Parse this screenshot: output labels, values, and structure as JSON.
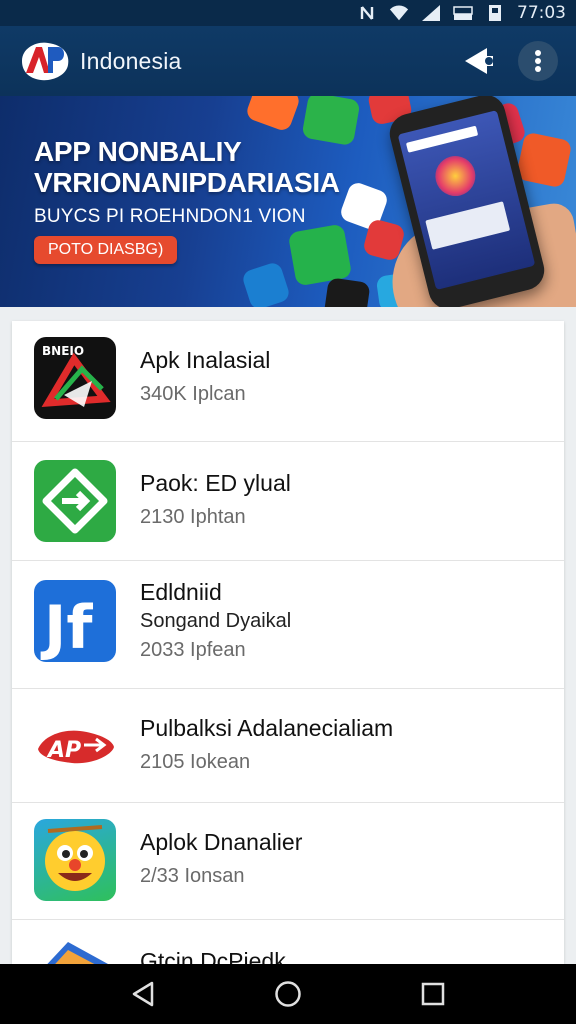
{
  "status_bar": {
    "time": "77:03",
    "icons": [
      "nfc-icon",
      "wifi-icon",
      "signal-icon",
      "battery-icon",
      "sim-icon"
    ]
  },
  "app_bar": {
    "logo_text": "AP",
    "title": "Indonesia",
    "icons": [
      "share-icon",
      "more-vert-icon"
    ]
  },
  "banner": {
    "title_line1": "APP NONBALIY",
    "title_line2": "VRRIONANIPDARIASIA",
    "subtitle": "BUYCS PI ROEHNDON1 VION",
    "button_label": "POTO DIASBG)"
  },
  "apps": [
    {
      "name": "Apk Inalasial",
      "developer": "",
      "meta": "340K Iplcan",
      "icon": "apk-triangle-icon",
      "color": "#111111"
    },
    {
      "name": "Paok: ED ylual",
      "developer": "",
      "meta": "2130 Iphtan",
      "icon": "green-diamond-icon",
      "color": "#2eaa44"
    },
    {
      "name": "Edldniid",
      "developer": "Songand Dyaikal",
      "meta": "2033 Ipfean",
      "icon": "jf-letter-icon",
      "color": "#1e6fd9"
    },
    {
      "name": "Pulbalksi Adalanecialiam",
      "developer": "",
      "meta": "2105 Iokean",
      "icon": "apk-red-logo-icon",
      "color": "#d72b2b"
    },
    {
      "name": "Aplok Dnanalier",
      "developer": "",
      "meta": "2/33 Ionsan",
      "icon": "smiley-face-icon",
      "color": "#2aa7de"
    },
    {
      "name": "Gtcin DcPiedk",
      "developer": "",
      "meta": "",
      "icon": "play-triangle-icon",
      "color": "#2d6bd1"
    }
  ],
  "nav_bar": {
    "icons": [
      "back-icon",
      "home-icon",
      "recents-icon"
    ]
  }
}
